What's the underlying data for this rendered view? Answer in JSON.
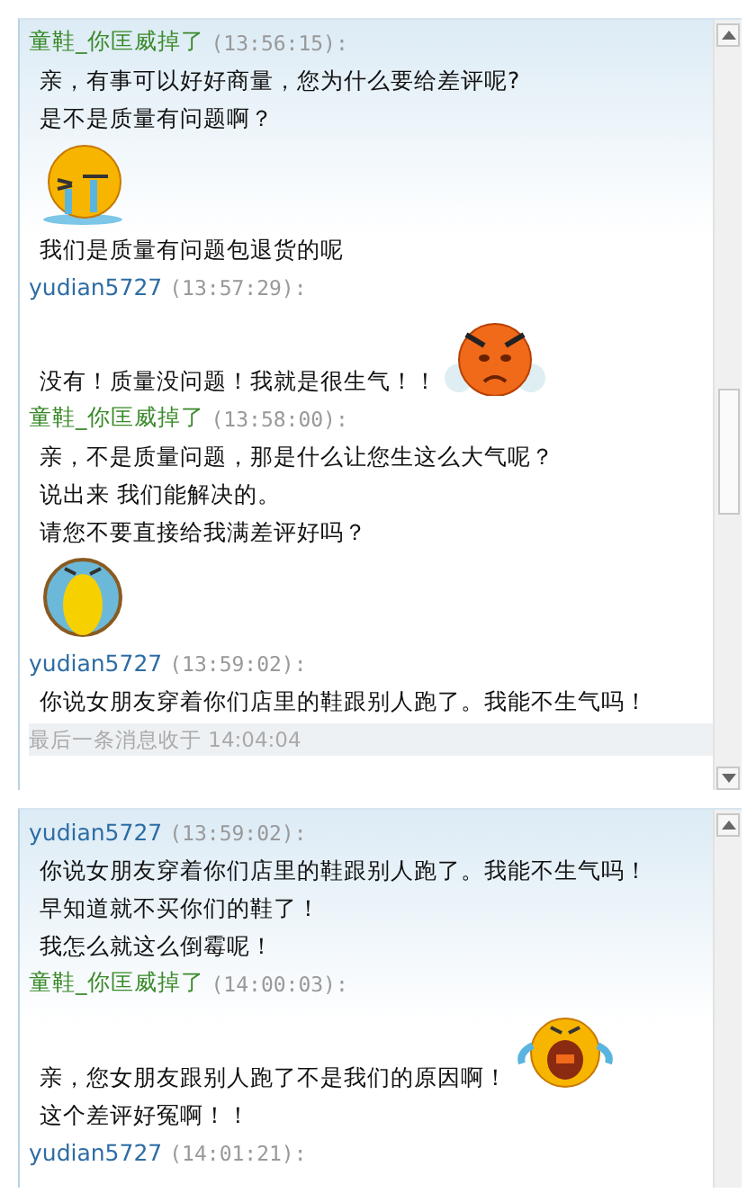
{
  "panels": [
    {
      "messages": [
        {
          "sender": "童鞋_你匡威掉了",
          "kind": "agent",
          "time": "(13:56:15):",
          "lines": [
            {
              "kind": "text",
              "text": "亲，有事可以好好商量，您为什么要给差评呢?"
            },
            {
              "kind": "text",
              "text": "是不是质量有问题啊？"
            },
            {
              "kind": "sobbing"
            },
            {
              "kind": "text",
              "text": "我们是质量有问题包退货的呢"
            }
          ]
        },
        {
          "sender": "yudian5727",
          "kind": "customer",
          "time": "(13:57:29):",
          "lines": [
            {
              "kind": "angry",
              "text": "没有！质量没问题！我就是很生气！！"
            }
          ]
        },
        {
          "sender": "童鞋_你匡威掉了",
          "kind": "agent",
          "time": "(13:58:00):",
          "lines": [
            {
              "kind": "text",
              "text": "亲，不是质量问题，那是什么让您生这么大气呢？"
            },
            {
              "kind": "text",
              "text": "说出来 我们能解决的。"
            },
            {
              "kind": "text",
              "text": "请您不要直接给我满差评好吗？"
            },
            {
              "kind": "pouting"
            }
          ]
        },
        {
          "sender": "yudian5727",
          "kind": "customer",
          "time": "(13:59:02):",
          "lines": [
            {
              "kind": "text",
              "text": "你说女朋友穿着你们店里的鞋跟别人跑了。我能不生气吗！"
            }
          ]
        }
      ],
      "footer": "最后一条消息收于 14:04:04"
    },
    {
      "messages": [
        {
          "sender": "yudian5727",
          "kind": "customer",
          "time": "(13:59:02):",
          "lines": [
            {
              "kind": "text",
              "text": "你说女朋友穿着你们店里的鞋跟别人跑了。我能不生气吗！"
            },
            {
              "kind": "text",
              "text": "早知道就不买你们的鞋了！"
            },
            {
              "kind": "text",
              "text": "我怎么就这么倒霉呢！"
            }
          ]
        },
        {
          "sender": "童鞋_你匡威掉了",
          "kind": "agent",
          "time": "(14:00:03):",
          "lines": [
            {
              "kind": "wailing",
              "text": "亲，您女朋友跟别人跑了不是我们的原因啊！"
            },
            {
              "kind": "text",
              "text": "这个差评好冤啊！！"
            }
          ]
        },
        {
          "sender": "yudian5727",
          "kind": "customer",
          "time": "(14:01:21):"
        }
      ]
    }
  ]
}
